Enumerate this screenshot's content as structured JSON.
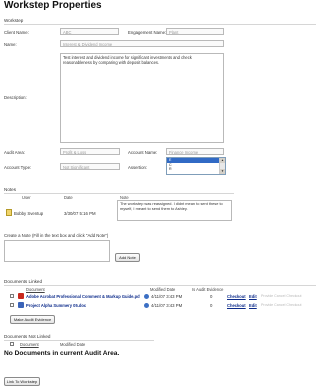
{
  "page_title": "Workstep Properties",
  "workstep_label": "Workstep",
  "client_name_label": "Client Name:",
  "client_name_value": "ABC",
  "engagement_name_label": "Engagement Name:",
  "engagement_name_value": "Plant",
  "name_label": "Name:",
  "name_value": "Interest & Dividend Income",
  "description_label": "Description:",
  "description_value": "Test interest and dividend income for significant investments and check reasonableness by comparing with deposit balances.",
  "audit_area_label": "Audit Area:",
  "audit_area_value": "Profit & Loss",
  "account_name_label": "Account Name:",
  "account_name_value": "Finance Income",
  "account_type_label": "Account Type:",
  "account_type_value": "Not Significant",
  "assertion_label": "Assertion:",
  "assertion_options": [
    "E",
    "C",
    "R"
  ],
  "assertion_up_arrow": "▲",
  "assertion_down_arrow": "▼",
  "notes": {
    "section_label": "Notes",
    "col_user": "User",
    "col_date": "Date",
    "col_note": "Note",
    "row": {
      "user": "Bobby Sventup",
      "date": "3/30/07 5:16 PM",
      "note": "The workstep was reassigned. I didnt mean to sent these to myself, I meant to send them to Ashley."
    },
    "create_label": "Create a Note (Fill in the text box and click \"Add Note\")",
    "add_button": "Add Note"
  },
  "documents_linked": {
    "section_label": "Documents Linked",
    "col_document": "Document",
    "col_modified": "Modified Date",
    "col_audit_evidence": "Is Audit Evidence",
    "rows": [
      {
        "name": "Adobe Acrobat Professional Comment & Markup Guide.pdf",
        "modified": "4/11/07 3:43 PM",
        "audit": "0",
        "checkout": "Checkout",
        "edit": "Edit",
        "extra": "Provide  Cancel  Checkout"
      },
      {
        "name": "Project Alpha Summery 05.doc",
        "modified": "4/11/07 3:43 PM",
        "audit": "0",
        "checkout": "Checkout",
        "edit": "Edit",
        "extra": "Provide  Cancel  Checkout"
      }
    ],
    "make_button": "Make Audit Evidence"
  },
  "documents_not_linked": {
    "section_label": "Documents Not Linked",
    "col_document": "Document",
    "col_modified": "Modified Date",
    "empty_message": "No Documents in current Audit Area.",
    "link_button": "Link To Workstep"
  }
}
